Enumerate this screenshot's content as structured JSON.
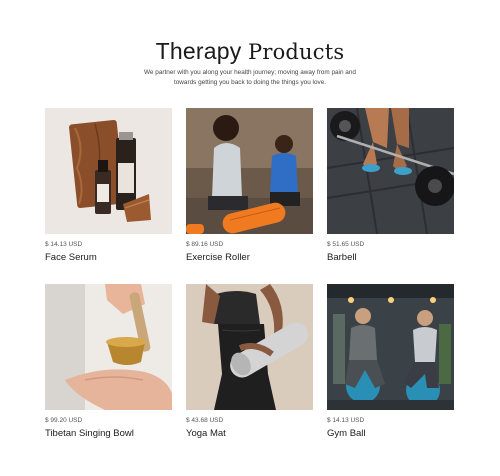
{
  "header": {
    "title_word1": "Therapy",
    "title_word2": "Products",
    "subtitle_line1": "We partner with you along your health journey; moving away from pain and",
    "subtitle_line2": "towards getting you back to doing the things you love."
  },
  "products": [
    {
      "price": "$ 14.13 USD",
      "name": "Face Serum",
      "image_icon": "face-serum-image"
    },
    {
      "price": "$ 89.16 USD",
      "name": "Exercise Roller",
      "image_icon": "exercise-roller-image"
    },
    {
      "price": "$ 51.65 USD",
      "name": "Barbell",
      "image_icon": "barbell-image"
    },
    {
      "price": "$ 99.20 USD",
      "name": "Tibetan Singing Bowl",
      "image_icon": "singing-bowl-image"
    },
    {
      "price": "$ 43.68 USD",
      "name": "Yoga Mat",
      "image_icon": "yoga-mat-image"
    },
    {
      "price": "$ 14.13 USD",
      "name": "Gym Ball",
      "image_icon": "gym-ball-image"
    }
  ]
}
